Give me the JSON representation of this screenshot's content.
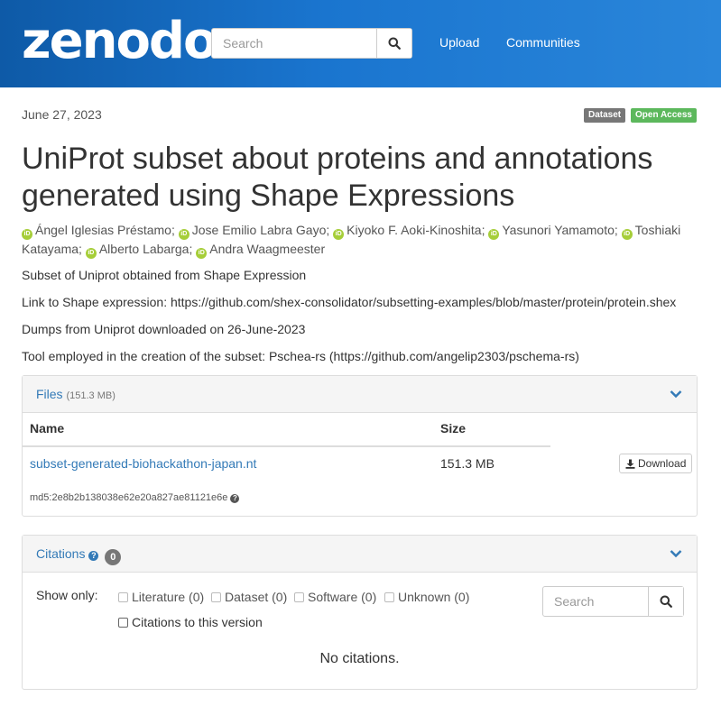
{
  "header": {
    "logo": "zenodo",
    "search_placeholder": "Search",
    "nav": [
      "Upload",
      "Communities"
    ],
    "icons": {
      "search": "search-icon"
    }
  },
  "record": {
    "date": "June 27, 2023",
    "badges": {
      "type": "Dataset",
      "access": "Open Access"
    },
    "title": "UniProt subset about proteins and annotations generated using Shape Expressions",
    "authors": [
      "Ángel Iglesias Préstamo;",
      "Jose Emilio Labra Gayo;",
      "Kiyoko F. Aoki-Kinoshita;",
      "Yasunori Yamamoto;",
      "Toshiaki Katayama;",
      "Alberto Labarga;",
      "Andra Waagmeester"
    ],
    "description": [
      "Subset of Uniprot obtained from Shape Expression",
      "Link to Shape expression: https://github.com/shex-consolidator/subsetting-examples/blob/master/protein/protein.shex",
      "Dumps from Uniprot downloaded on 26-June-2023",
      "Tool employed in the creation of the subset: Pschea-rs (https://github.com/angelip2303/pschema-rs)"
    ]
  },
  "files": {
    "title": "Files",
    "total_size": "(151.3 MB)",
    "columns": {
      "name": "Name",
      "size": "Size"
    },
    "rows": [
      {
        "name": "subset-generated-biohackathon-japan.nt",
        "size": "151.3 MB",
        "action": "Download",
        "md5": "md5:2e8b2b138038e62e20a827ae81121e6e"
      }
    ]
  },
  "citations": {
    "title": "Citations",
    "count": "0",
    "show_only": "Show only:",
    "filters": [
      "Literature (0)",
      "Dataset (0)",
      "Software (0)",
      "Unknown (0)"
    ],
    "version_filter": "Citations to this version",
    "search_placeholder": "Search",
    "empty": "No citations."
  },
  "colors": {
    "header_start": "#0e5aa7",
    "header_end": "#2a86da",
    "link": "#337ab7",
    "access_badge": "#5cb85c",
    "type_badge": "#777777",
    "orcid": "#a6ce39"
  }
}
